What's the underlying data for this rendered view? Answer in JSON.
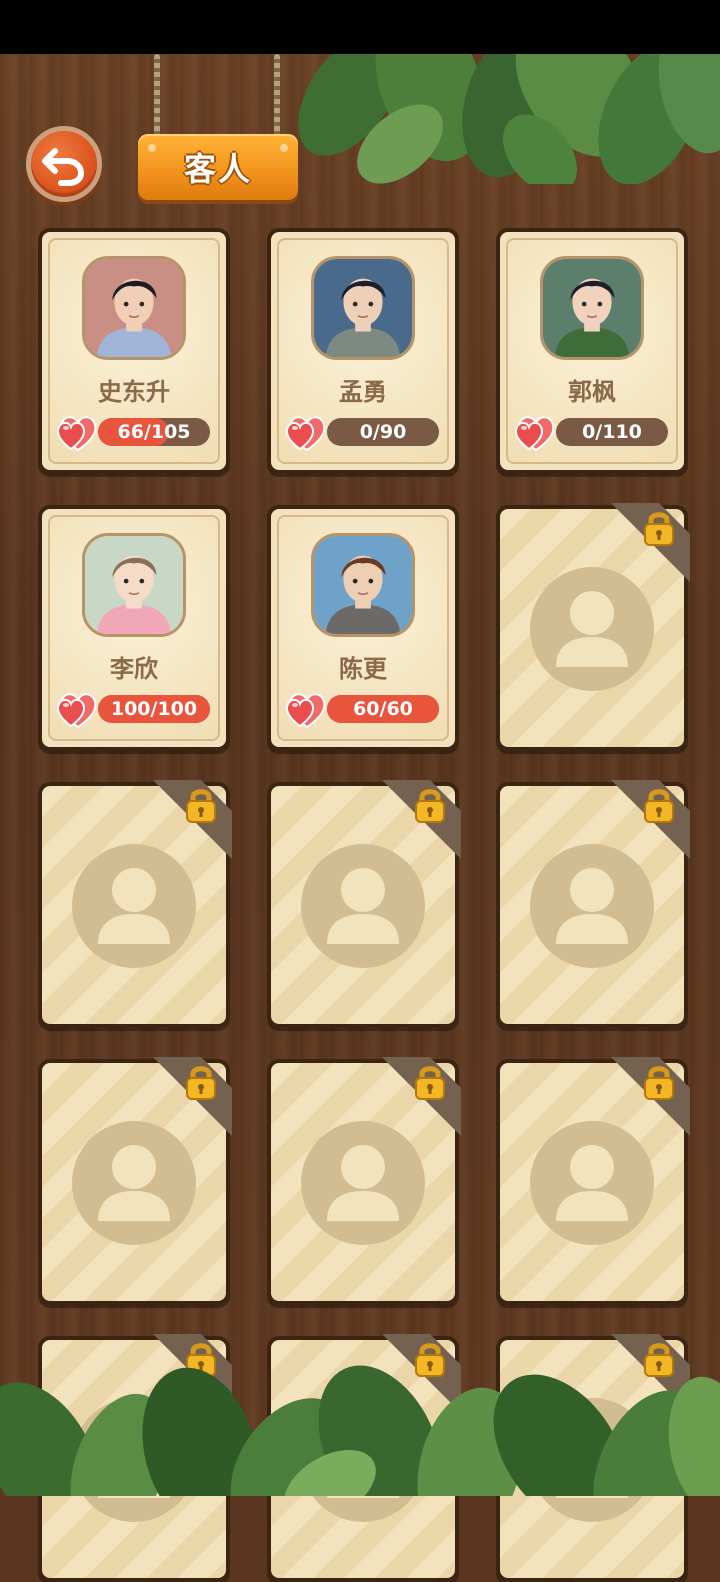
{
  "header": {
    "title": "客人"
  },
  "guests": [
    {
      "name": "史东升",
      "affection_text": "66/105",
      "affection": 0.63,
      "locked": false,
      "style": "a"
    },
    {
      "name": "孟勇",
      "affection_text": "0/90",
      "affection": 0.0,
      "locked": false,
      "style": "b"
    },
    {
      "name": "郭枫",
      "affection_text": "0/110",
      "affection": 0.0,
      "locked": false,
      "style": "c"
    },
    {
      "name": "李欣",
      "affection_text": "100/100",
      "affection": 1.0,
      "locked": false,
      "style": "d"
    },
    {
      "name": "陈更",
      "affection_text": "60/60",
      "affection": 1.0,
      "locked": false,
      "style": "e"
    },
    {
      "locked": true
    },
    {
      "locked": true
    },
    {
      "locked": true
    },
    {
      "locked": true
    },
    {
      "locked": true
    },
    {
      "locked": true
    },
    {
      "locked": true
    },
    {
      "locked": true
    },
    {
      "locked": true
    },
    {
      "locked": true
    }
  ],
  "icons": {
    "back": "back-arrow-icon",
    "lock": "padlock-icon",
    "heart": "heart-icon",
    "placeholder": "user-silhouette-icon"
  },
  "colors": {
    "accent": "#f2921b",
    "bar_fill": "#e9543d",
    "bar_empty": "#7a5a44",
    "name_text": "#8a6a4a"
  }
}
